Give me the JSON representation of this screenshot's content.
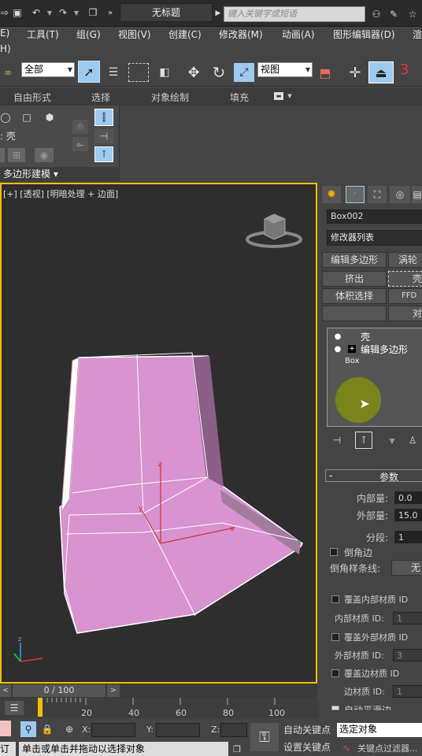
{
  "title": "无标题",
  "search": {
    "placeholder": "键入关键字或短语"
  },
  "menu": [
    "E)",
    "工具(T)",
    "组(G)",
    "视图(V)",
    "创建(C)",
    "修改器(M)",
    "动画(A)",
    "图形编辑器(D)",
    "渲",
    "H)"
  ],
  "toolbar": {
    "filter_value": "全部",
    "refcoord_value": "视图",
    "snap_label": "3"
  },
  "ribbon_tabs": [
    "自由形式",
    "选择",
    "对象绘制",
    "填充"
  ],
  "ribbon": {
    "shell_label": ": 壳",
    "group_label": "多边形建模 ▾"
  },
  "viewport": {
    "label": "[+] [透视] [明暗处理 + 边面]",
    "gizmo_axes": {
      "x": "x",
      "y": "y",
      "z": "z"
    }
  },
  "command_panel": {
    "object_name": "Box002",
    "modifier_list": "修改器列表",
    "buttons": [
      "编辑多边形",
      "涡轮",
      "挤出",
      "壳",
      "体积选择",
      "FFD",
      "",
      "对"
    ],
    "stack": [
      {
        "label": "壳",
        "selected": true
      },
      {
        "label": "编辑多边形",
        "selected": false
      },
      {
        "label": "Box",
        "selected": false
      }
    ],
    "rollout_title": "参数",
    "params": {
      "inner_label": "内部量:",
      "inner_value": "0.0",
      "outer_label": "外部量:",
      "outer_value": "15.0",
      "segments_label": "分段:",
      "segments_value": "1",
      "bevel_edges": "倒角边",
      "bevel_spline_label": "倒角样条线:",
      "bevel_spline_value": "无",
      "override_inner": "覆盖内部材质 ID",
      "inner_mat_label": "内部材质 ID:",
      "inner_mat_value": "1",
      "override_outer": "覆盖外部材质 ID",
      "outer_mat_label": "外部材质 ID:",
      "outer_mat_value": "3",
      "override_edge": "覆盖边材质 ID",
      "edge_mat_label": "边材质 ID:",
      "edge_mat_value": "1",
      "auto_smooth": "自动平滑边"
    }
  },
  "timeline": {
    "frame": "0 / 100",
    "ticks": [
      "20",
      "40",
      "60",
      "80",
      "100"
    ]
  },
  "status": {
    "x_label": "X:",
    "y_label": "Y:",
    "z_label": "Z:",
    "auto_key": "自动关键点",
    "set_key": "设置关键点",
    "selection_value": "选定对象",
    "key_filter": "关键点过滤器...",
    "prompt": "单击或单击并拖动以选择对象",
    "left_tag": "订"
  },
  "colors": {
    "accent": "#f0c000",
    "object": "#d893d0",
    "selected_button": "#9ecaf0"
  }
}
